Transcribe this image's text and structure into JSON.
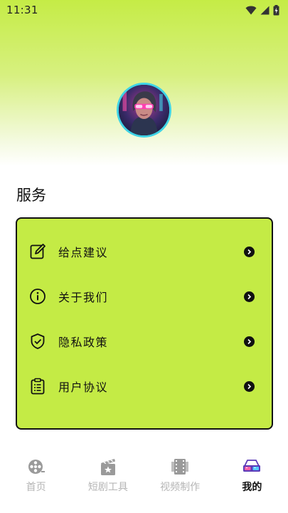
{
  "status_bar": {
    "time": "11:31",
    "icons": [
      "wifi-icon",
      "signal-icon",
      "battery-icon"
    ]
  },
  "profile": {
    "avatar_icon": "avatar-icon",
    "avatar_ring_color": "#3fd3e6"
  },
  "services": {
    "title": "服务",
    "card_color": "#c4eb45",
    "items": [
      {
        "label": "给点建议",
        "icon": "edit-icon"
      },
      {
        "label": "关于我们",
        "icon": "info-icon"
      },
      {
        "label": "隐私政策",
        "icon": "shield-check-icon"
      },
      {
        "label": "用户协议",
        "icon": "clipboard-icon"
      }
    ]
  },
  "tab_bar": {
    "tabs": [
      {
        "label": "首页",
        "icon": "film-reel-icon",
        "active": false
      },
      {
        "label": "短剧工具",
        "icon": "clapperboard-icon",
        "active": false
      },
      {
        "label": "视频制作",
        "icon": "film-strip-icon",
        "active": false
      },
      {
        "label": "我的",
        "icon": "3d-glasses-icon",
        "active": true
      }
    ]
  }
}
